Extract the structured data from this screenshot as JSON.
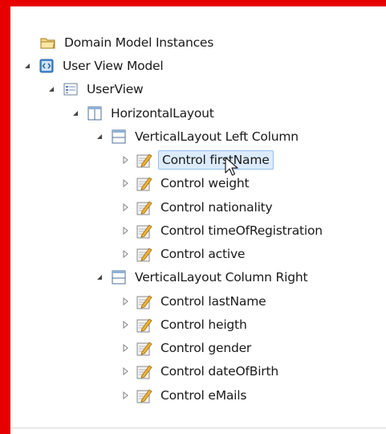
{
  "tree": {
    "items": [
      {
        "label": "Domain Model Instances",
        "icon": "folder-icon"
      },
      {
        "label": "User View Model",
        "icon": "view-model-icon"
      },
      {
        "label": "UserView",
        "icon": "form-view-icon"
      },
      {
        "label": "HorizontalLayout",
        "icon": "horizontal-layout-icon"
      },
      {
        "label": "VerticalLayout Left Column",
        "icon": "vertical-layout-icon"
      },
      {
        "label": "Control firstName",
        "icon": "control-icon",
        "selected": true
      },
      {
        "label": "Control weight",
        "icon": "control-icon"
      },
      {
        "label": "Control nationality",
        "icon": "control-icon"
      },
      {
        "label": "Control timeOfRegistration",
        "icon": "control-icon"
      },
      {
        "label": "Control active",
        "icon": "control-icon"
      },
      {
        "label": "VerticalLayout Column Right",
        "icon": "vertical-layout-icon"
      },
      {
        "label": "Control lastName",
        "icon": "control-icon"
      },
      {
        "label": "Control heigth",
        "icon": "control-icon"
      },
      {
        "label": "Control gender",
        "icon": "control-icon"
      },
      {
        "label": "Control dateOfBirth",
        "icon": "control-icon"
      },
      {
        "label": "Control eMails",
        "icon": "control-icon"
      }
    ]
  },
  "colors": {
    "frame": "#e60000",
    "selection_bg": "#dcebfb",
    "selection_border": "#93c0ee"
  }
}
